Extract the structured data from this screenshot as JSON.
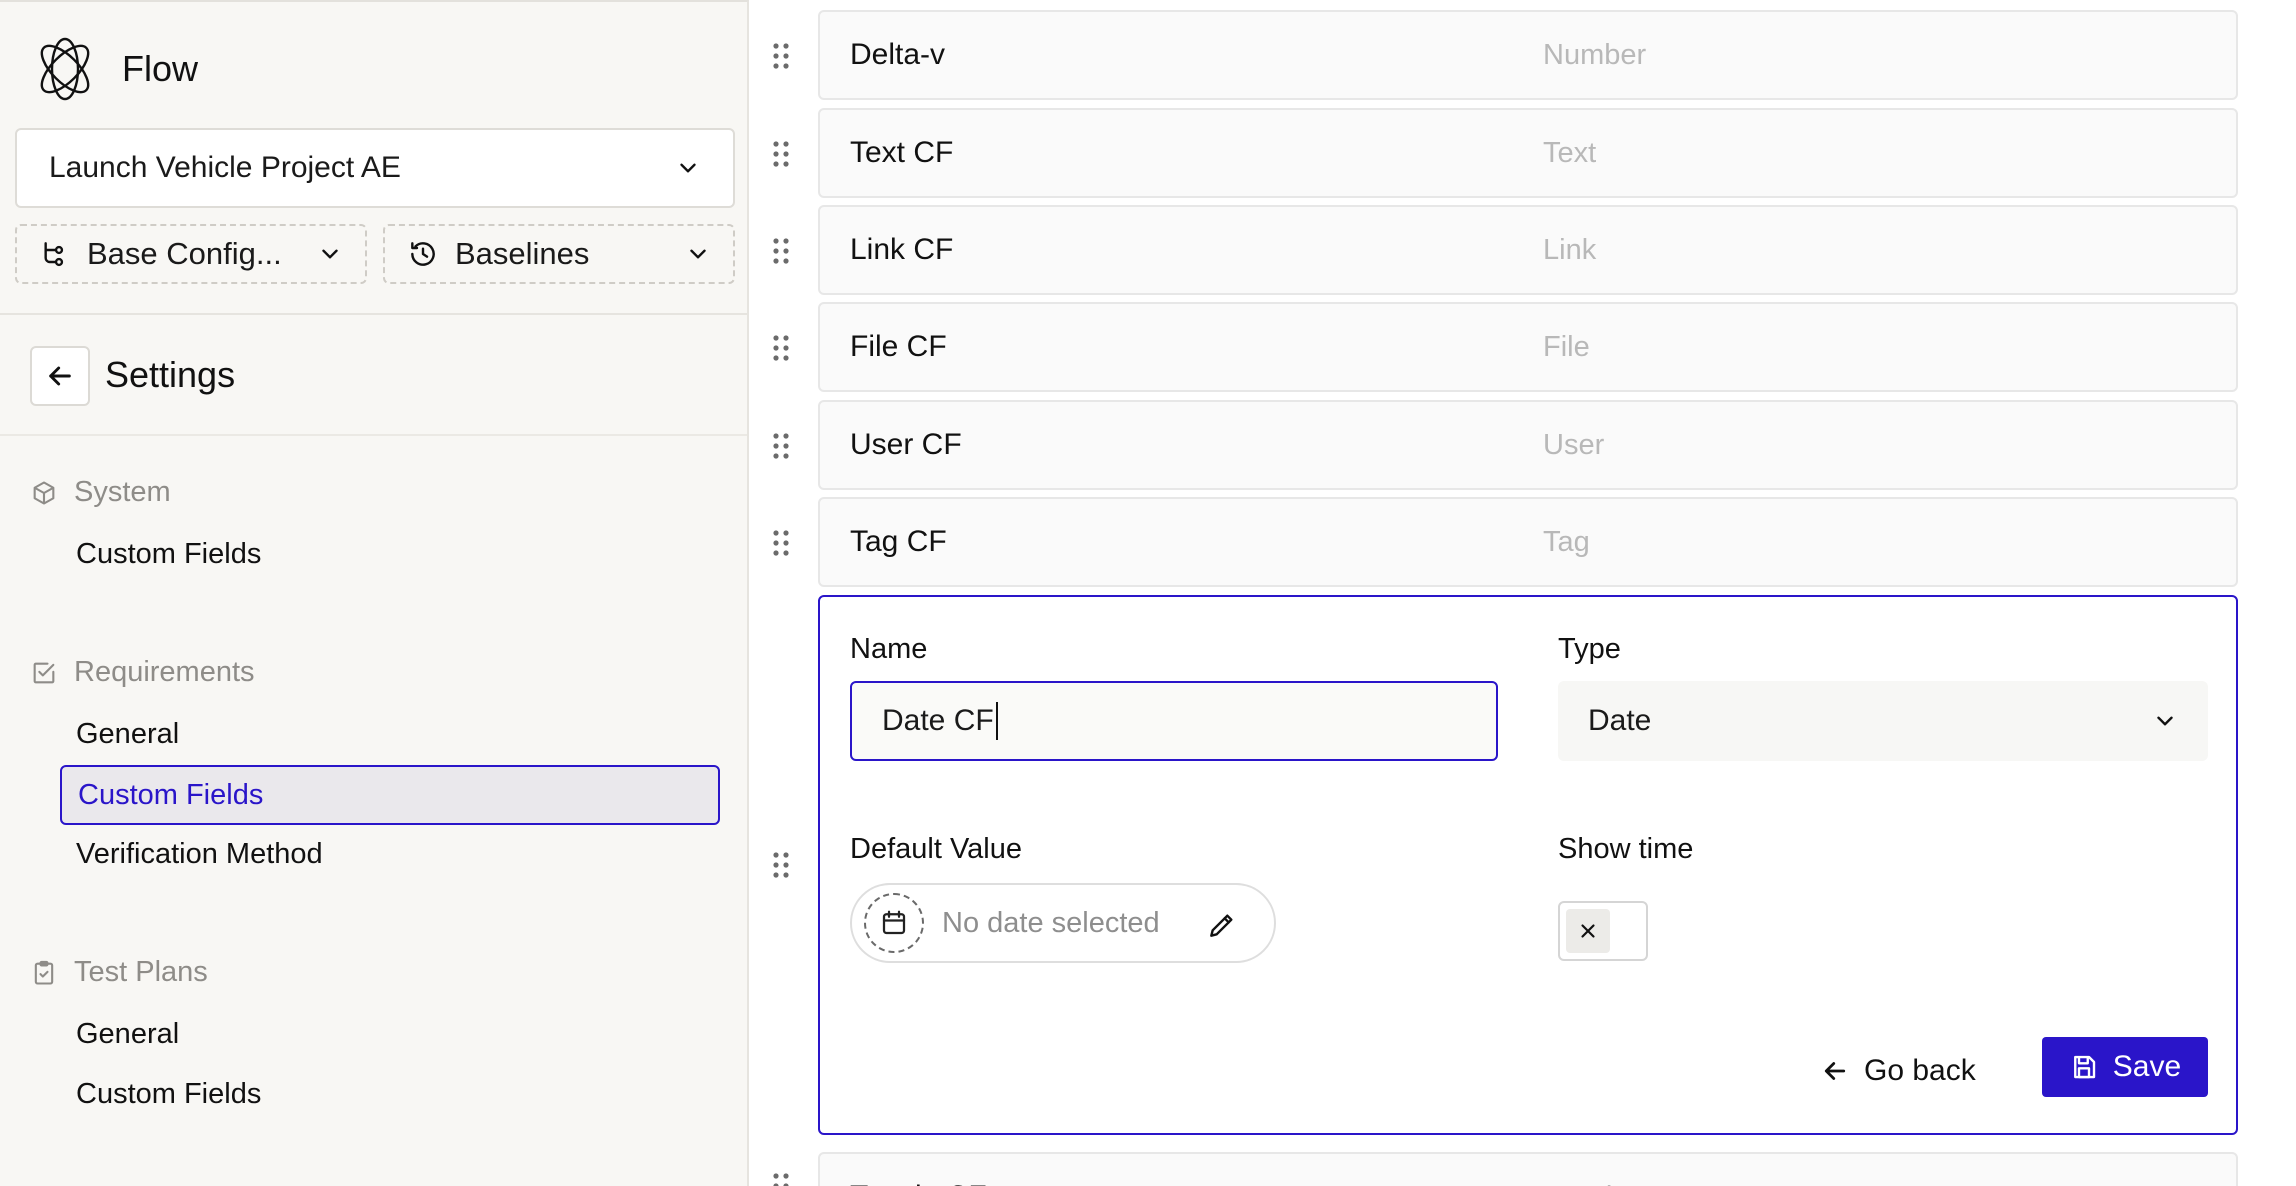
{
  "app": {
    "name": "Flow"
  },
  "project_select": {
    "value": "Launch Vehicle Project AE"
  },
  "config_select": {
    "value": "Base Config..."
  },
  "baselines_select": {
    "value": "Baselines"
  },
  "settings": {
    "title": "Settings"
  },
  "sidebar": {
    "sections": [
      {
        "title": "System",
        "items": [
          "Custom Fields"
        ]
      },
      {
        "title": "Requirements",
        "items": [
          "General",
          "Custom Fields",
          "Verification Method"
        ]
      },
      {
        "title": "Test Plans",
        "items": [
          "General",
          "Custom Fields"
        ]
      }
    ]
  },
  "fields": [
    {
      "name": "Delta-v",
      "type": "Number"
    },
    {
      "name": "Text CF",
      "type": "Text"
    },
    {
      "name": "Link CF",
      "type": "Link"
    },
    {
      "name": "File CF",
      "type": "File"
    },
    {
      "name": "User CF",
      "type": "User"
    },
    {
      "name": "Tag CF",
      "type": "Tag"
    }
  ],
  "next_field": {
    "name": "Toggle CF",
    "type": "Toggle"
  },
  "editor": {
    "name_label": "Name",
    "name_value": "Date CF",
    "type_label": "Type",
    "type_value": "Date",
    "default_label": "Default Value",
    "default_placeholder": "No date selected",
    "show_time_label": "Show time",
    "show_time_value": false,
    "go_back_label": "Go back",
    "save_label": "Save"
  },
  "colors": {
    "accent": "#2a15c9",
    "sidebar_bg": "#f8f7f4",
    "muted_text": "#8e8c88"
  }
}
